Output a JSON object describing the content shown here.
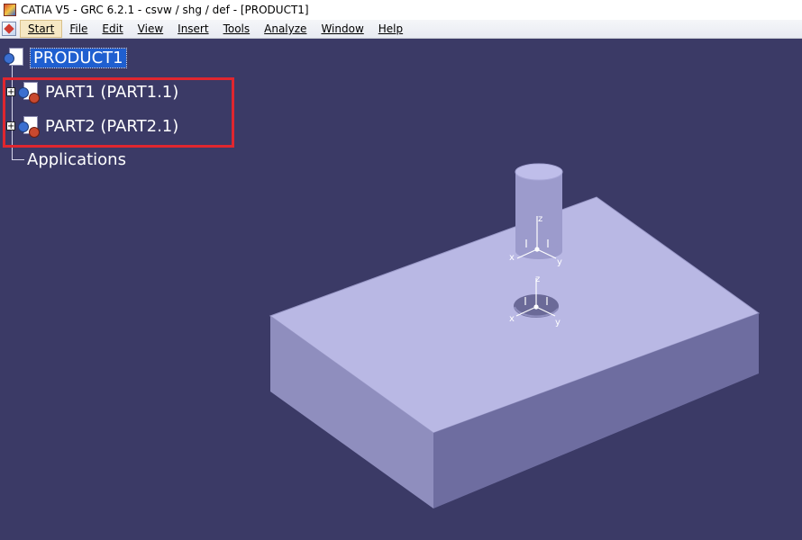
{
  "window": {
    "title": "CATIA V5 - GRC 6.2.1 - csvw / shg / def - [PRODUCT1]"
  },
  "menu": {
    "items": [
      {
        "label": "Start",
        "active": true
      },
      {
        "label": "File"
      },
      {
        "label": "Edit"
      },
      {
        "label": "View"
      },
      {
        "label": "Insert"
      },
      {
        "label": "Tools"
      },
      {
        "label": "Analyze"
      },
      {
        "label": "Window"
      },
      {
        "label": "Help"
      }
    ]
  },
  "tree": {
    "root": "PRODUCT1",
    "children": [
      {
        "label": "PART1 (PART1.1)"
      },
      {
        "label": "PART2 (PART2.1)"
      }
    ],
    "applications": "Applications"
  },
  "axes": {
    "x": "x",
    "y": "y",
    "z": "z"
  },
  "colors": {
    "background": "#3b3a66",
    "highlight": "#e0262f",
    "selection": "#1f5fd0",
    "solid_top": "#b9b8e4",
    "solid_front": "#8f8ebe",
    "solid_side": "#6e6da0"
  }
}
